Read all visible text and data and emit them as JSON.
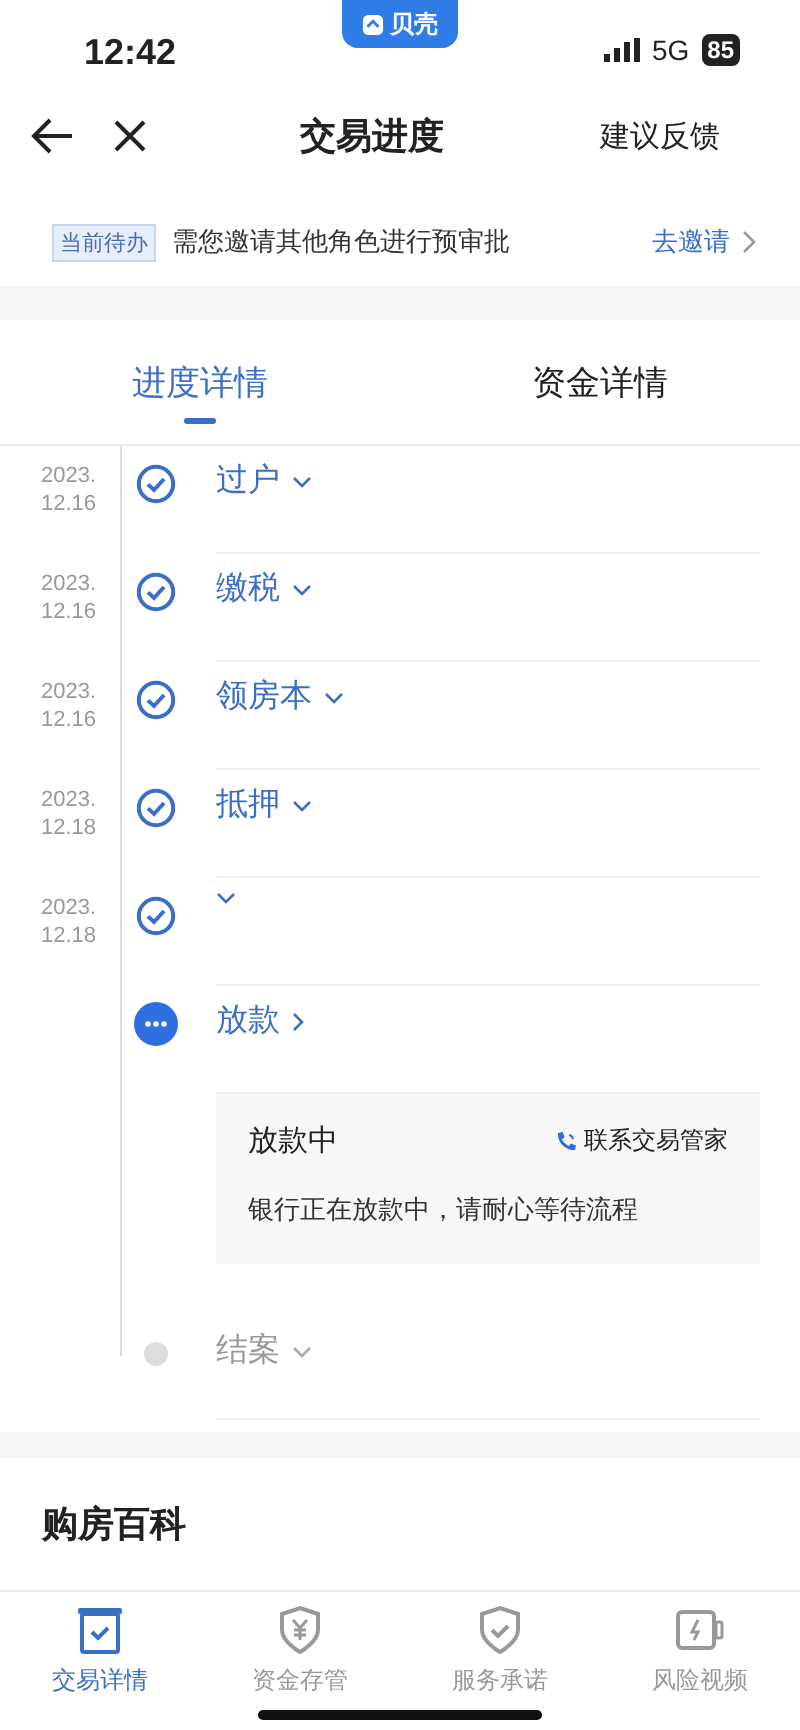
{
  "status_bar": {
    "time": "12:42",
    "app_badge": "贝壳",
    "network": "5G",
    "battery": "85"
  },
  "nav": {
    "title": "交易进度",
    "action": "建议反馈"
  },
  "todo": {
    "tag": "当前待办",
    "message": "需您邀请其他角色进行预审批",
    "link": "去邀请"
  },
  "tabs": [
    {
      "label": "进度详情",
      "selected": true
    },
    {
      "label": "资金详情",
      "selected": false
    }
  ],
  "steps": [
    {
      "year": "2023.",
      "day": "12.16",
      "label": "过户",
      "kind": "done"
    },
    {
      "year": "2023.",
      "day": "12.16",
      "label": "缴税",
      "kind": "done"
    },
    {
      "year": "2023.",
      "day": "12.16",
      "label": "领房本",
      "kind": "done"
    },
    {
      "year": "2023.",
      "day": "12.18",
      "label": "抵押",
      "kind": "done"
    },
    {
      "year": "2023.",
      "day": "12.18",
      "kind": "done"
    },
    {
      "label": "放款",
      "kind": "current",
      "detail": {
        "title": "放款中",
        "contact": "联系交易管家",
        "message": "银行正在放款中，请耐心等待流程"
      }
    },
    {
      "label": "结案",
      "kind": "pending"
    }
  ],
  "section": {
    "title": "购房百科"
  },
  "bottom_tabs": [
    {
      "label": "交易详情",
      "selected": true,
      "kind": "box"
    },
    {
      "label": "资金存管",
      "selected": false,
      "kind": "yen"
    },
    {
      "label": "服务承诺",
      "selected": false,
      "kind": "shield"
    },
    {
      "label": "风险视频",
      "selected": false,
      "kind": "video"
    }
  ]
}
